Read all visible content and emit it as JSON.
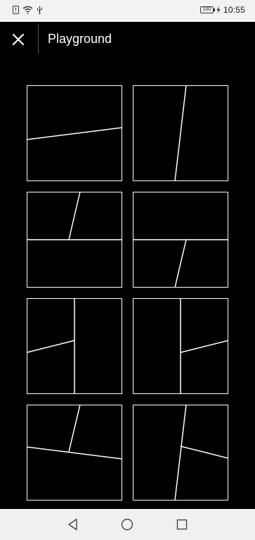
{
  "status_bar": {
    "time": "10:55",
    "battery": "100",
    "icons": [
      "alert-icon",
      "wifi-icon",
      "usb-icon"
    ]
  },
  "header": {
    "title": "Playground",
    "close_icon": "close-icon"
  },
  "layouts": [
    {
      "name": "layout-1"
    },
    {
      "name": "layout-2"
    },
    {
      "name": "layout-3"
    },
    {
      "name": "layout-4"
    },
    {
      "name": "layout-5"
    },
    {
      "name": "layout-6"
    },
    {
      "name": "layout-7"
    },
    {
      "name": "layout-8"
    }
  ],
  "nav_bar": {
    "icons": [
      "back-triangle-icon",
      "home-circle-icon",
      "recents-square-icon"
    ]
  },
  "colors": {
    "background": "#000000",
    "stroke": "#ffffff",
    "status_bar": "#f2f2f2",
    "nav_bar": "#f0f0f0"
  }
}
